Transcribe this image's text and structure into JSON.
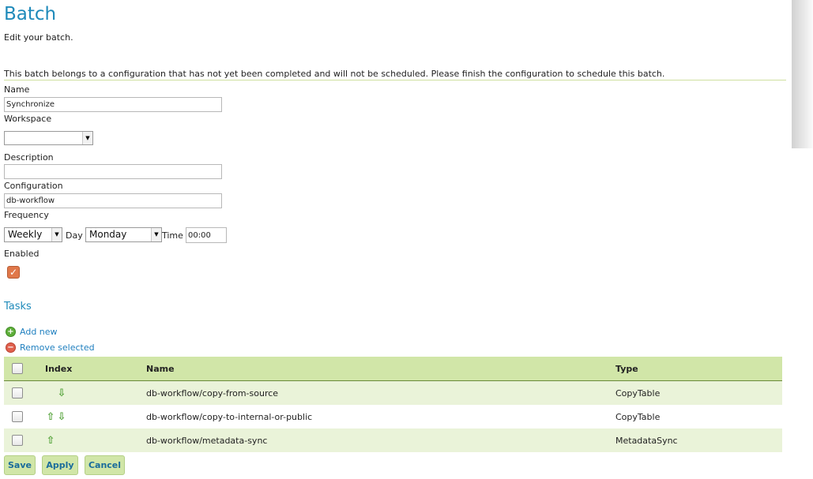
{
  "header": {
    "title": "Batch",
    "subtitle": "Edit your batch."
  },
  "warning": "This batch belongs to a configuration that has not yet been completed and will not be scheduled. Please finish the configuration to schedule this batch.",
  "form": {
    "name_label": "Name",
    "name_value": "Synchronize",
    "workspace_label": "Workspace",
    "workspace_value": "",
    "description_label": "Description",
    "description_value": "",
    "configuration_label": "Configuration",
    "configuration_value": "db-workflow",
    "frequency_label": "Frequency",
    "frequency_value": "Weekly",
    "day_label": "Day",
    "day_value": "Monday",
    "time_label": "Time",
    "time_value": "00:00",
    "enabled_label": "Enabled",
    "enabled_checked": true
  },
  "tasks": {
    "title": "Tasks",
    "add_label": "Add new",
    "remove_label": "Remove selected",
    "columns": [
      "Index",
      "Name",
      "Type"
    ],
    "rows": [
      {
        "name": "db-workflow/copy-from-source",
        "type": "CopyTable",
        "up": false,
        "down": true
      },
      {
        "name": "db-workflow/copy-to-internal-or-public",
        "type": "CopyTable",
        "up": true,
        "down": true
      },
      {
        "name": "db-workflow/metadata-sync",
        "type": "MetadataSync",
        "up": true,
        "down": false
      }
    ]
  },
  "buttons": {
    "save": "Save",
    "apply": "Apply",
    "cancel": "Cancel"
  },
  "colors": {
    "accent": "#1f8aba",
    "table_header": "#d1e6a8",
    "row_highlight": "#eaf3d9"
  }
}
